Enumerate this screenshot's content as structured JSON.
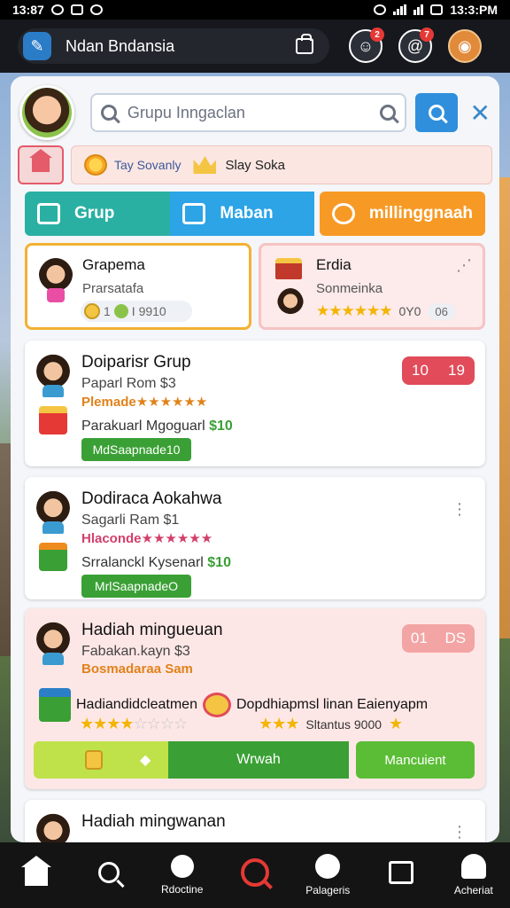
{
  "status_bar": {
    "time_left": "13:87",
    "time_right": "13:3:PM"
  },
  "header": {
    "app_title": "Ndan Bndansia",
    "badge_1": "2",
    "badge_2": "7"
  },
  "search": {
    "placeholder": "Grupu Inngaclan"
  },
  "filters": {
    "chip1": "Tay Sovanly",
    "chip2": "Slay Soka"
  },
  "tabs": [
    "Grup",
    "Maban",
    "millinggnaah"
  ],
  "mini_cards": [
    {
      "name": "Grapema",
      "sub": "Prarsatafa",
      "stat_a": "1",
      "stat_b": "I 9910"
    },
    {
      "name": "Erdia",
      "sub": "Sonmeinka",
      "stars": "★★★★★★",
      "count": "0Y0",
      "tag": "06"
    }
  ],
  "cards": [
    {
      "title": "Doiparisr Grup",
      "sub": "Paparl Rom $3",
      "sub2": "Plemade★★★★★★",
      "prize": "Parakuarl Mgoguarl",
      "prize_amt": "$10",
      "button": "MdSaapnade10",
      "badge_a": "10",
      "badge_b": "19"
    },
    {
      "title": "Dodiraca Aokahwa",
      "sub": "Sagarli Ram $1",
      "sub2": "Hlaconde★★★★★★",
      "prize": "Srralanckl Kysenarl",
      "prize_amt": "$10",
      "button": "MrlSaapnadeO"
    }
  ],
  "hadiah_card": {
    "title": "Hadiah mingueuan",
    "sub": "Fabakan.kayn $3",
    "sub2": "Bosmadaraa Sam",
    "badge_a": "01",
    "badge_b": "DS",
    "prize_left": "Hadiandidcleatmen",
    "prize_right": "Dopdhiapmsl linan Eaienyapm",
    "stars_right_text": "Sltantus 9000",
    "btn_mid": "Wrwah",
    "btn_right": "Mancuient"
  },
  "last_card": {
    "title": "Hadiah mingwanan"
  },
  "bottom_nav": [
    {
      "label": ""
    },
    {
      "label": ""
    },
    {
      "label": "Rdoctine"
    },
    {
      "label": ""
    },
    {
      "label": "Palageris"
    },
    {
      "label": ""
    },
    {
      "label": "Acheriat"
    }
  ]
}
